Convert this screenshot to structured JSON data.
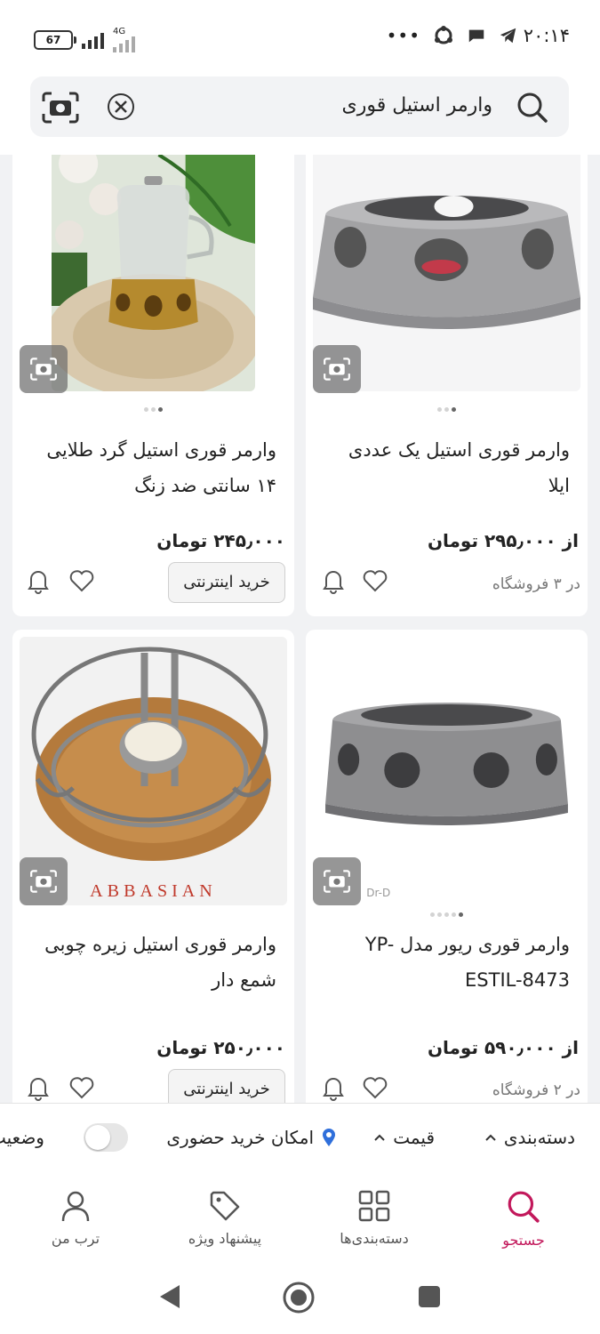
{
  "status_bar": {
    "time": "۲۰:۱۴",
    "battery": "67",
    "network": "4G"
  },
  "search": {
    "query": "وارمر استیل قوری"
  },
  "products": [
    {
      "title": "وارمر قوری استیل یک عددی ایلا",
      "price": "از ۲۹۵٫۰۰۰ تومان",
      "shops": "در ۳ فروشگاه",
      "buy_label": ""
    },
    {
      "title": "وارمر قوری استیل گرد طلایی ۱۴ سانتی ضد زنگ",
      "price": "۲۴۵٫۰۰۰ تومان",
      "shops": "",
      "buy_label": "خرید اینترنتی"
    },
    {
      "title": "وارمر قوری ریور مدل YP-ESTIL-8473",
      "price": "از ۵۹۰٫۰۰۰ تومان",
      "shops": "در ۲ فروشگاه",
      "buy_label": ""
    },
    {
      "title": "وارمر قوری استیل زیره چوبی شمع دار",
      "price": "۲۵۰٫۰۰۰ تومان",
      "shops": "",
      "buy_label": "خرید اینترنتی"
    }
  ],
  "image_text": {
    "brand_stamp": "ABBASIAN"
  },
  "filters": {
    "category": "دسته‌بندی",
    "price": "قیمت",
    "in_person": "امکان خرید حضوری",
    "status": "وضعیت"
  },
  "tabs": {
    "search": "جستجو",
    "categories": "دسته‌بندی‌ها",
    "offers": "پیشنهاد ویژه",
    "profile": "ترب من"
  },
  "colors": {
    "accent": "#c2185b",
    "location_pin": "#2f6fdb"
  }
}
